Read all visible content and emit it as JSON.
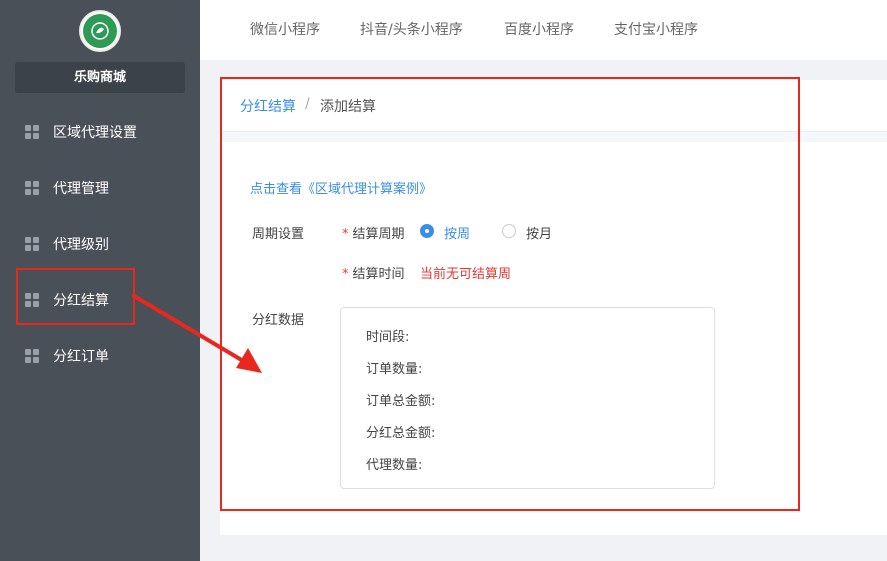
{
  "sidebar": {
    "shop_name": "乐购商城",
    "items": [
      {
        "label": "区域代理设置",
        "icon": "grid-icon"
      },
      {
        "label": "代理管理",
        "icon": "grid-icon"
      },
      {
        "label": "代理级别",
        "icon": "grid-icon"
      },
      {
        "label": "分红结算",
        "icon": "grid-icon"
      },
      {
        "label": "分红订单",
        "icon": "grid-icon"
      }
    ]
  },
  "topbar": {
    "tabs": [
      "微信小程序",
      "抖音/头条小程序",
      "百度小程序",
      "支付宝小程序"
    ]
  },
  "breadcrumb": {
    "parent": "分红结算",
    "separator": "/",
    "current": "添加结算"
  },
  "form": {
    "case_link": "点击查看《区域代理计算案例》",
    "period_label": "周期设置",
    "cycle_label": "结算周期",
    "options": [
      "按周",
      "按月"
    ],
    "selected_option": "按周",
    "time_label": "结算时间",
    "time_value": "当前无可结算周",
    "data_label": "分红数据",
    "data_rows": [
      "时间段:",
      "订单数量:",
      "订单总金额:",
      "分红总金额:",
      "代理数量:"
    ]
  },
  "colors": {
    "sidebar_bg": "#4a5057",
    "accent": "#3a8ee6",
    "highlight": "#e8281e",
    "warning": "#e53935"
  }
}
